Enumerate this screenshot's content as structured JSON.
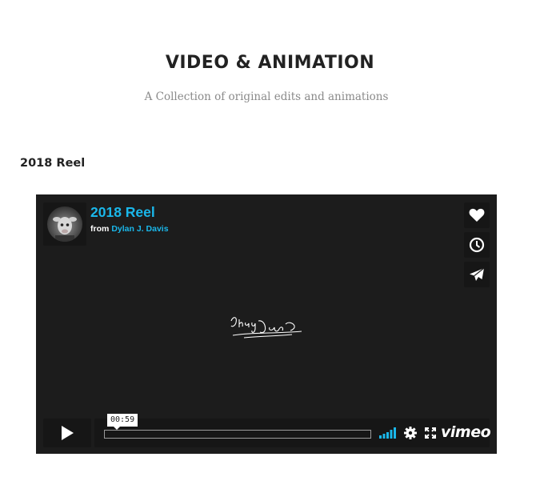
{
  "header": {
    "title": "VIDEO & ANIMATION",
    "subtitle": "A Collection of original edits and animations"
  },
  "section": {
    "heading": "2018 Reel"
  },
  "player": {
    "title": "2018 Reel",
    "byline_prefix": "from",
    "author": "Dylan J. Davis",
    "time_tooltip": "00:59",
    "logo": "vimeo",
    "icons": {
      "like": "heart-icon",
      "watch_later": "clock-icon",
      "share": "paper-plane-icon",
      "play": "play-icon",
      "volume": "volume-bars-icon",
      "settings": "gear-icon",
      "fullscreen": "fullscreen-icon"
    },
    "colors": {
      "accent": "#1ab7ea",
      "background": "#1c1c1c",
      "control_bg": "#161616"
    }
  }
}
